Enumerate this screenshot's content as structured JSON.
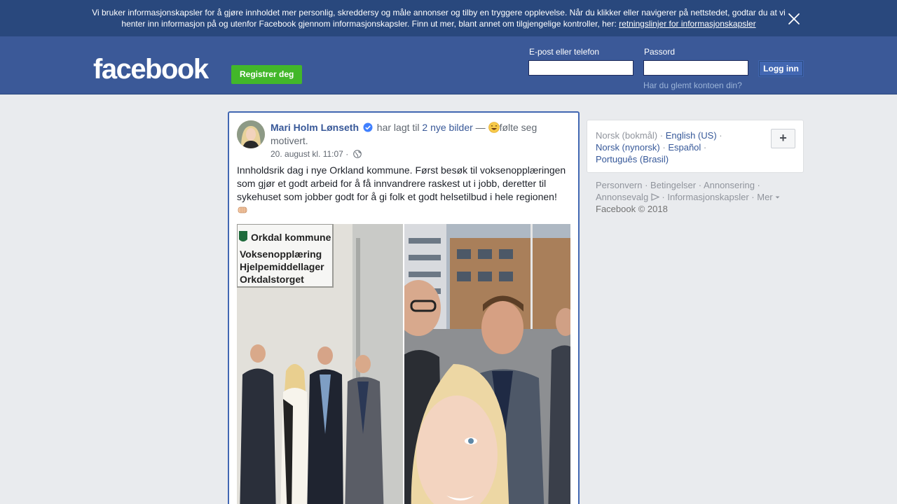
{
  "cookie_banner": {
    "text": "Vi bruker informasjonskapsler for å gjøre innholdet mer personlig, skreddersy og måle annonser og tilby en tryggere opplevelse. Når du klikker eller navigerer på nettstedet, godtar du at vi henter inn informasjon på og utenfor Facebook gjennom informasjonskapsler. Finn ut mer, blant annet om tilgjengelige kontroller, her: ",
    "link": "retningslinjer for informasjonskapsler",
    "close_icon": "close-icon"
  },
  "header": {
    "logo": "facebook",
    "register_label": "Registrer deg",
    "email_label": "E-post eller telefon",
    "password_label": "Passord",
    "login_label": "Logg inn",
    "forgot_label": "Har du glemt kontoen din?"
  },
  "post": {
    "author": "Mari Holm Lønseth",
    "action": "har lagt til",
    "photos_link": "2 nye bilder",
    "dash": "—",
    "feeling": "følte seg motivert.",
    "timestamp": "20. august kl. 11:07",
    "privacy_sep": "·",
    "privacy_icon": "globe-icon",
    "body": "Innholdsrik dag i nye Orkland kommune. Først besøk til voksenopplæringen som gjør et godt arbeid for å få innvandrere raskest ut i jobb, deretter til sykehuset som jobber godt for å gi folk et godt helsetilbud i hele regionen!",
    "sign": {
      "line1": "Orkdal kommune",
      "line2": "Voksenopplæring",
      "line3": "Hjelpemiddellager",
      "line4": "Orkdalstorget"
    }
  },
  "languages": {
    "current": "Norsk (bokmål)",
    "items": [
      "English (US)",
      "Norsk (nynorsk)",
      "Español",
      "Português (Brasil)"
    ],
    "add_label": "+"
  },
  "footer": {
    "links": [
      "Personvern",
      "Betingelser",
      "Annonsering",
      "Annonsevalg",
      "Informasjonskapsler",
      "Mer"
    ],
    "copyright": "Facebook © 2018"
  },
  "colors": {
    "brand_blue": "#3b5998",
    "banner_blue": "#29487d",
    "register_green": "#42b72a",
    "link_blue": "#385898"
  }
}
